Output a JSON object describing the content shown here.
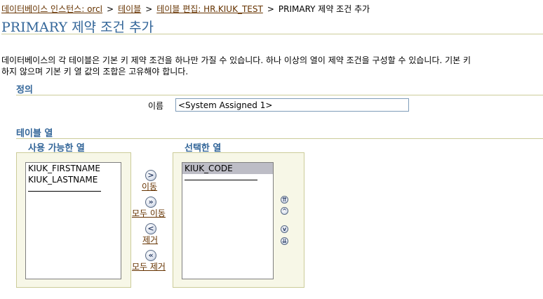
{
  "breadcrumb": {
    "items": [
      "데이터베이스 인스턴스: orcl",
      "테이블",
      "테이블 편집: HR.KIUK_TEST"
    ],
    "separator": ">",
    "current": "PRIMARY 제약 조건 추가"
  },
  "page_title": "PRIMARY 제약 조건 추가",
  "description": {
    "line1": "데이터베이스의 각 테이블은 기본 키 제약 조건을 하나만 가질 수 있습니다. 하나 이상의 열이 제약 조건을 구성할 수 있습니다. 기본 키",
    "line2": "하지 않으며 기본 키 열 값의 조합은 고유해야 합니다."
  },
  "definition": {
    "heading": "정의",
    "name_label": "이름",
    "name_value": "<System Assigned 1>"
  },
  "columns": {
    "heading": "테이블 열",
    "available_label": "사용 가능한 열",
    "available_items": [
      "KIUK_FIRSTNAME",
      "KIUK_LASTNAME"
    ],
    "selected_label": "선택한 열",
    "selected_items": [
      "KIUK_CODE"
    ],
    "move_label": "이동",
    "move_all_label": "모두 이동",
    "remove_label": "제거",
    "remove_all_label": "모두 제거"
  },
  "icons": {
    "move": "move-right-icon",
    "move_all": "move-all-right-icon",
    "remove": "move-left-icon",
    "remove_all": "move-all-left-icon",
    "order": [
      "move-top-icon",
      "move-up-icon",
      "move-down-icon",
      "move-bottom-icon"
    ]
  },
  "colors": {
    "link": "#663300",
    "heading": "#336699",
    "rule": "#cccc99",
    "panel": "#f7f7e7",
    "selected_row": "#bdbdc6"
  }
}
